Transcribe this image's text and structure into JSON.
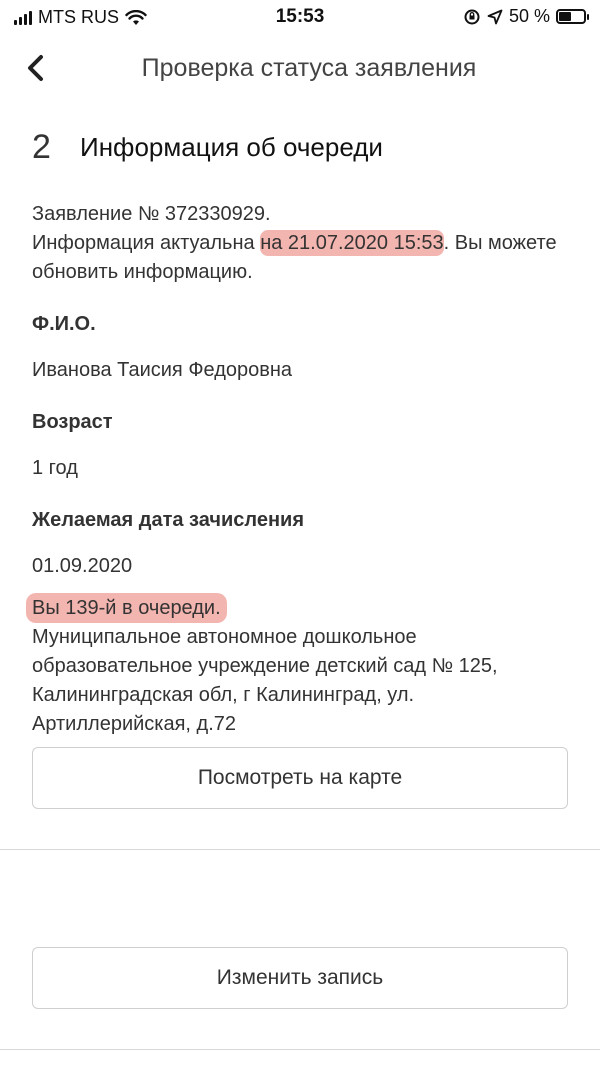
{
  "status_bar": {
    "carrier": "MTS RUS",
    "time": "15:53",
    "battery": "50 %"
  },
  "nav": {
    "title": "Проверка статуса заявления"
  },
  "section": {
    "step": "2",
    "title": "Информация об очереди"
  },
  "info": {
    "application": "Заявление № 372330929.",
    "actual_prefix": "Информация актуальна ",
    "actual_highlight": "на 21.07.2020 15:53",
    "actual_suffix": ". Вы можете обновить информацию."
  },
  "fields": [
    {
      "label": "Ф.И.О.",
      "value": "Иванова Таисия Федоровна"
    },
    {
      "label": "Возраст",
      "value": "1 год"
    },
    {
      "label": "Желаемая дата зачисления",
      "value": "01.09.2020"
    }
  ],
  "queue": {
    "position": "Вы 139-й в очереди.",
    "institution": "Муниципальное автономное дошкольное образовательное учреждение детский сад № 125, Калининградская обл, г Калининград, ул. Артиллерийская, д.72"
  },
  "buttons": {
    "map": "Посмотреть на карте",
    "edit": "Изменить запись"
  }
}
